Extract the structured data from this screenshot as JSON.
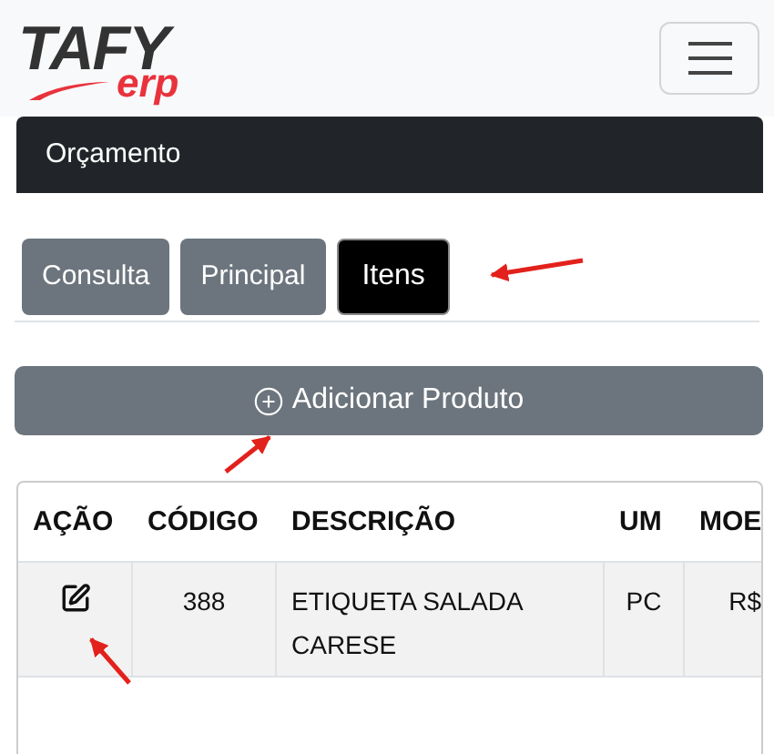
{
  "logo": {
    "main": "TAFY",
    "sub": "erp"
  },
  "card": {
    "title": "Orçamento"
  },
  "tabs": [
    {
      "label": "Consulta",
      "selected": false
    },
    {
      "label": "Principal",
      "selected": false
    },
    {
      "label": "Itens",
      "selected": true
    }
  ],
  "add_button": {
    "label": "Adicionar Produto"
  },
  "table": {
    "columns": [
      "AÇÃO",
      "CÓDIGO",
      "DESCRIÇÃO",
      "UM",
      "MOE"
    ],
    "rows": [
      {
        "code": "388",
        "description": "ETIQUETA SALADA CARESE",
        "unit": "PC",
        "currency": "R$"
      }
    ]
  }
}
